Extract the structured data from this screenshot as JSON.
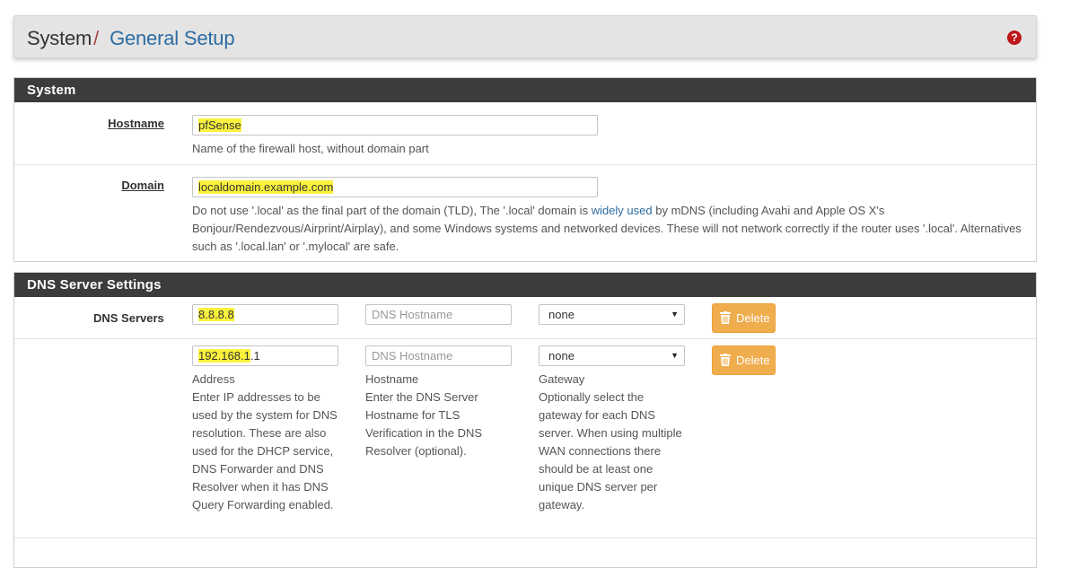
{
  "breadcrumb": {
    "root": "System",
    "separator": "/",
    "current": "General Setup",
    "help_icon": "question-circle-icon"
  },
  "system_panel": {
    "title": "System",
    "hostname": {
      "label": "Hostname",
      "value_highlighted": "pfSense",
      "help": "Name of the firewall host, without domain part"
    },
    "domain": {
      "label": "Domain",
      "value_highlighted": "localdomain.example.com",
      "help_before_link": "Do not use '.local' as the final part of the domain (TLD), The '.local' domain is ",
      "help_link": "widely used",
      "help_after_link": " by mDNS (including Avahi and Apple OS X's Bonjour/Rendezvous/Airprint/Airplay), and some Windows systems and networked devices. These will not network correctly if the router uses '.local'. Alternatives such as '.local.lan' or '.mylocal' are safe."
    }
  },
  "dns_panel": {
    "title": "DNS Server Settings",
    "label": "DNS Servers",
    "rows": [
      {
        "address_highlighted": "8.8.8.8",
        "address_rest": "",
        "hostname_placeholder": "DNS Hostname",
        "gateway": "none",
        "delete_label": "Delete"
      },
      {
        "address_highlighted": "192.168.1",
        "address_rest": ".1",
        "hostname_placeholder": "DNS Hostname",
        "gateway": "none",
        "delete_label": "Delete"
      }
    ],
    "address_help_title": "Address",
    "address_help": "Enter IP addresses to be used by the system for DNS resolution. These are also used for the DHCP service, DNS Forwarder and DNS Resolver when it has DNS Query Forwarding enabled.",
    "hostname_help_title": "Hostname",
    "hostname_help": "Enter the DNS Server Hostname for TLS Verification in the DNS Resolver (optional).",
    "gateway_help_title": "Gateway",
    "gateway_help": "Optionally select the gateway for each DNS server. When using multiple WAN connections there should be at least one unique DNS server per gateway."
  },
  "colors": {
    "panel_heading": "#3c3c3c",
    "link": "#2d6ca2",
    "highlight": "#fbf23d",
    "delete_button": "#f0ad4e",
    "breadcrumb_separator": "#a94442"
  }
}
